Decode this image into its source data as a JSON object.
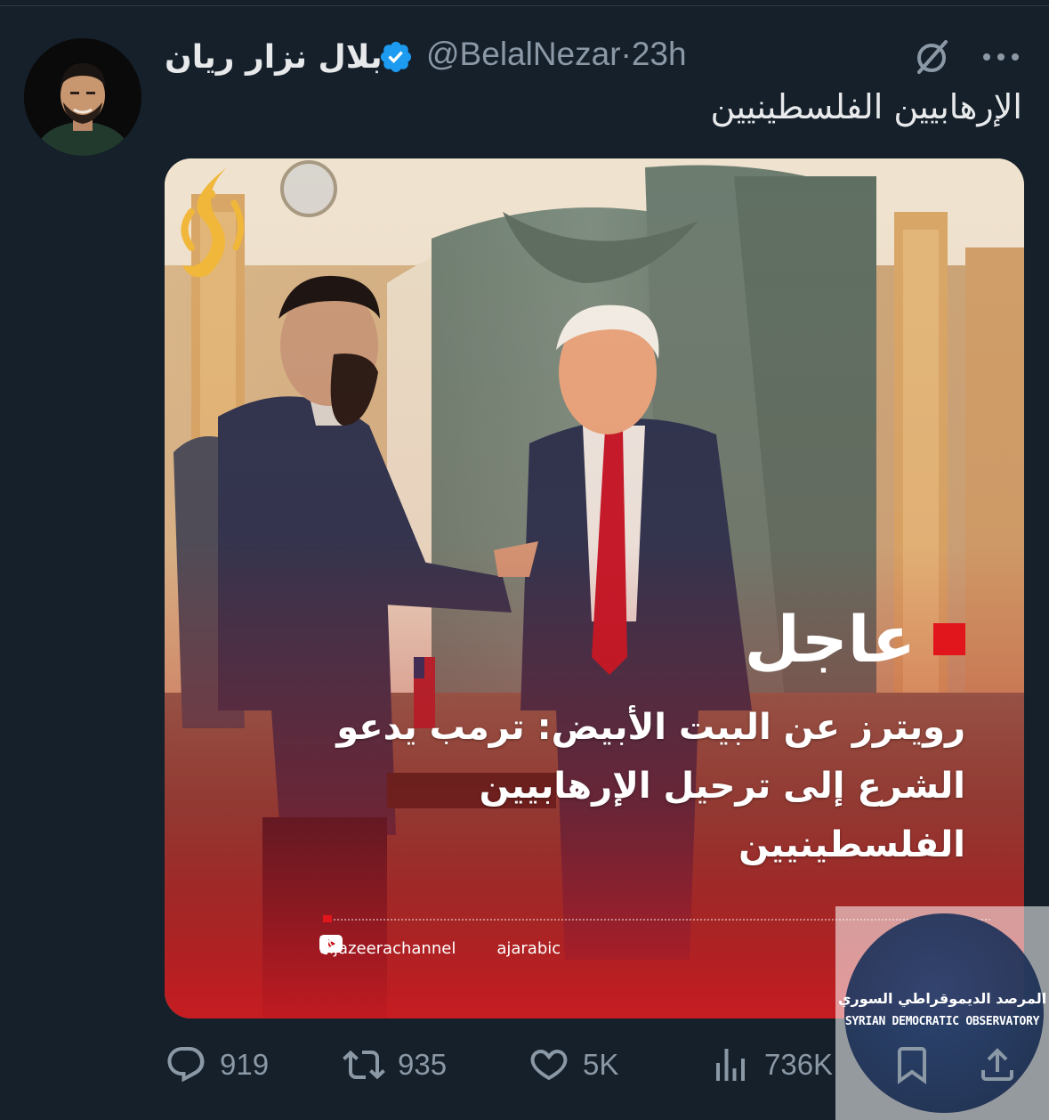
{
  "tweet": {
    "author": {
      "display_name": "بلال نزار ريان",
      "handle": "@BelalNezar",
      "verified": true,
      "avatar_icon": "profile-photo"
    },
    "separator": "·",
    "time": "23h",
    "text": "الإرهابيين الفلسطينيين",
    "header_icons": [
      "grok-icon",
      "more-icon"
    ]
  },
  "media": {
    "badge": "عاجل",
    "headline_lines": [
      "رويترز عن البيت الأبيض: ترمب يدعو",
      "الشرع إلى ترحيل الإرهابيين",
      "الفلسطينيين"
    ],
    "social": {
      "facebook_youtube_handle": "aljazeerachannel",
      "x_handle": "ajarabic"
    },
    "logo": "aljazeera-logo",
    "accent_color": "#e1151c"
  },
  "watermark": {
    "arabic": "المرصد الديموقراطي السوري",
    "english": "SYRIAN DEMOCRATIC OBSERVATORY"
  },
  "actions": {
    "replies": "919",
    "reposts": "935",
    "likes": "5K",
    "views": "736K"
  },
  "colors": {
    "background": "#15202b",
    "text": "#e7e9ea",
    "muted": "#8b98a5",
    "verified": "#1d9bf0"
  }
}
